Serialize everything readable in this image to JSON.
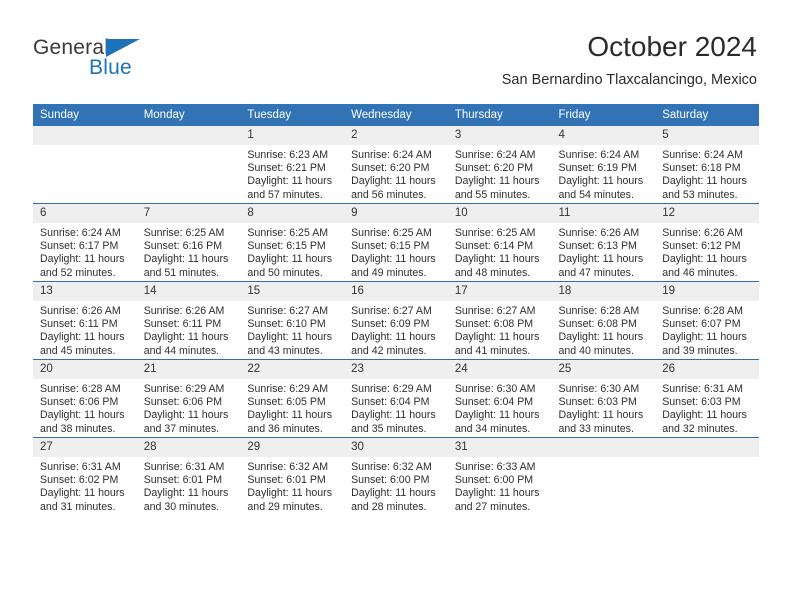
{
  "brand": {
    "name_top": "General",
    "name_bottom": "Blue",
    "triangle_color": "#1c72bb"
  },
  "header": {
    "title": "October 2024",
    "subtitle": "San Bernardino Tlaxcalancingo, Mexico"
  },
  "theme": {
    "header_bg": "#3273b5",
    "daynum_bg": "#efefef",
    "row_line": "#2f6fb0"
  },
  "weekday_headers": [
    "Sunday",
    "Monday",
    "Tuesday",
    "Wednesday",
    "Thursday",
    "Friday",
    "Saturday"
  ],
  "weeks": [
    [
      {
        "day": "",
        "empty": true
      },
      {
        "day": "",
        "empty": true
      },
      {
        "day": "1",
        "sunrise": "Sunrise: 6:23 AM",
        "sunset": "Sunset: 6:21 PM",
        "daylight1": "Daylight: 11 hours",
        "daylight2": "and 57 minutes."
      },
      {
        "day": "2",
        "sunrise": "Sunrise: 6:24 AM",
        "sunset": "Sunset: 6:20 PM",
        "daylight1": "Daylight: 11 hours",
        "daylight2": "and 56 minutes."
      },
      {
        "day": "3",
        "sunrise": "Sunrise: 6:24 AM",
        "sunset": "Sunset: 6:20 PM",
        "daylight1": "Daylight: 11 hours",
        "daylight2": "and 55 minutes."
      },
      {
        "day": "4",
        "sunrise": "Sunrise: 6:24 AM",
        "sunset": "Sunset: 6:19 PM",
        "daylight1": "Daylight: 11 hours",
        "daylight2": "and 54 minutes."
      },
      {
        "day": "5",
        "sunrise": "Sunrise: 6:24 AM",
        "sunset": "Sunset: 6:18 PM",
        "daylight1": "Daylight: 11 hours",
        "daylight2": "and 53 minutes."
      }
    ],
    [
      {
        "day": "6",
        "sunrise": "Sunrise: 6:24 AM",
        "sunset": "Sunset: 6:17 PM",
        "daylight1": "Daylight: 11 hours",
        "daylight2": "and 52 minutes."
      },
      {
        "day": "7",
        "sunrise": "Sunrise: 6:25 AM",
        "sunset": "Sunset: 6:16 PM",
        "daylight1": "Daylight: 11 hours",
        "daylight2": "and 51 minutes."
      },
      {
        "day": "8",
        "sunrise": "Sunrise: 6:25 AM",
        "sunset": "Sunset: 6:15 PM",
        "daylight1": "Daylight: 11 hours",
        "daylight2": "and 50 minutes."
      },
      {
        "day": "9",
        "sunrise": "Sunrise: 6:25 AM",
        "sunset": "Sunset: 6:15 PM",
        "daylight1": "Daylight: 11 hours",
        "daylight2": "and 49 minutes."
      },
      {
        "day": "10",
        "sunrise": "Sunrise: 6:25 AM",
        "sunset": "Sunset: 6:14 PM",
        "daylight1": "Daylight: 11 hours",
        "daylight2": "and 48 minutes."
      },
      {
        "day": "11",
        "sunrise": "Sunrise: 6:26 AM",
        "sunset": "Sunset: 6:13 PM",
        "daylight1": "Daylight: 11 hours",
        "daylight2": "and 47 minutes."
      },
      {
        "day": "12",
        "sunrise": "Sunrise: 6:26 AM",
        "sunset": "Sunset: 6:12 PM",
        "daylight1": "Daylight: 11 hours",
        "daylight2": "and 46 minutes."
      }
    ],
    [
      {
        "day": "13",
        "sunrise": "Sunrise: 6:26 AM",
        "sunset": "Sunset: 6:11 PM",
        "daylight1": "Daylight: 11 hours",
        "daylight2": "and 45 minutes."
      },
      {
        "day": "14",
        "sunrise": "Sunrise: 6:26 AM",
        "sunset": "Sunset: 6:11 PM",
        "daylight1": "Daylight: 11 hours",
        "daylight2": "and 44 minutes."
      },
      {
        "day": "15",
        "sunrise": "Sunrise: 6:27 AM",
        "sunset": "Sunset: 6:10 PM",
        "daylight1": "Daylight: 11 hours",
        "daylight2": "and 43 minutes."
      },
      {
        "day": "16",
        "sunrise": "Sunrise: 6:27 AM",
        "sunset": "Sunset: 6:09 PM",
        "daylight1": "Daylight: 11 hours",
        "daylight2": "and 42 minutes."
      },
      {
        "day": "17",
        "sunrise": "Sunrise: 6:27 AM",
        "sunset": "Sunset: 6:08 PM",
        "daylight1": "Daylight: 11 hours",
        "daylight2": "and 41 minutes."
      },
      {
        "day": "18",
        "sunrise": "Sunrise: 6:28 AM",
        "sunset": "Sunset: 6:08 PM",
        "daylight1": "Daylight: 11 hours",
        "daylight2": "and 40 minutes."
      },
      {
        "day": "19",
        "sunrise": "Sunrise: 6:28 AM",
        "sunset": "Sunset: 6:07 PM",
        "daylight1": "Daylight: 11 hours",
        "daylight2": "and 39 minutes."
      }
    ],
    [
      {
        "day": "20",
        "sunrise": "Sunrise: 6:28 AM",
        "sunset": "Sunset: 6:06 PM",
        "daylight1": "Daylight: 11 hours",
        "daylight2": "and 38 minutes."
      },
      {
        "day": "21",
        "sunrise": "Sunrise: 6:29 AM",
        "sunset": "Sunset: 6:06 PM",
        "daylight1": "Daylight: 11 hours",
        "daylight2": "and 37 minutes."
      },
      {
        "day": "22",
        "sunrise": "Sunrise: 6:29 AM",
        "sunset": "Sunset: 6:05 PM",
        "daylight1": "Daylight: 11 hours",
        "daylight2": "and 36 minutes."
      },
      {
        "day": "23",
        "sunrise": "Sunrise: 6:29 AM",
        "sunset": "Sunset: 6:04 PM",
        "daylight1": "Daylight: 11 hours",
        "daylight2": "and 35 minutes."
      },
      {
        "day": "24",
        "sunrise": "Sunrise: 6:30 AM",
        "sunset": "Sunset: 6:04 PM",
        "daylight1": "Daylight: 11 hours",
        "daylight2": "and 34 minutes."
      },
      {
        "day": "25",
        "sunrise": "Sunrise: 6:30 AM",
        "sunset": "Sunset: 6:03 PM",
        "daylight1": "Daylight: 11 hours",
        "daylight2": "and 33 minutes."
      },
      {
        "day": "26",
        "sunrise": "Sunrise: 6:31 AM",
        "sunset": "Sunset: 6:03 PM",
        "daylight1": "Daylight: 11 hours",
        "daylight2": "and 32 minutes."
      }
    ],
    [
      {
        "day": "27",
        "sunrise": "Sunrise: 6:31 AM",
        "sunset": "Sunset: 6:02 PM",
        "daylight1": "Daylight: 11 hours",
        "daylight2": "and 31 minutes."
      },
      {
        "day": "28",
        "sunrise": "Sunrise: 6:31 AM",
        "sunset": "Sunset: 6:01 PM",
        "daylight1": "Daylight: 11 hours",
        "daylight2": "and 30 minutes."
      },
      {
        "day": "29",
        "sunrise": "Sunrise: 6:32 AM",
        "sunset": "Sunset: 6:01 PM",
        "daylight1": "Daylight: 11 hours",
        "daylight2": "and 29 minutes."
      },
      {
        "day": "30",
        "sunrise": "Sunrise: 6:32 AM",
        "sunset": "Sunset: 6:00 PM",
        "daylight1": "Daylight: 11 hours",
        "daylight2": "and 28 minutes."
      },
      {
        "day": "31",
        "sunrise": "Sunrise: 6:33 AM",
        "sunset": "Sunset: 6:00 PM",
        "daylight1": "Daylight: 11 hours",
        "daylight2": "and 27 minutes."
      },
      {
        "day": "",
        "empty": true
      },
      {
        "day": "",
        "empty": true
      }
    ]
  ]
}
